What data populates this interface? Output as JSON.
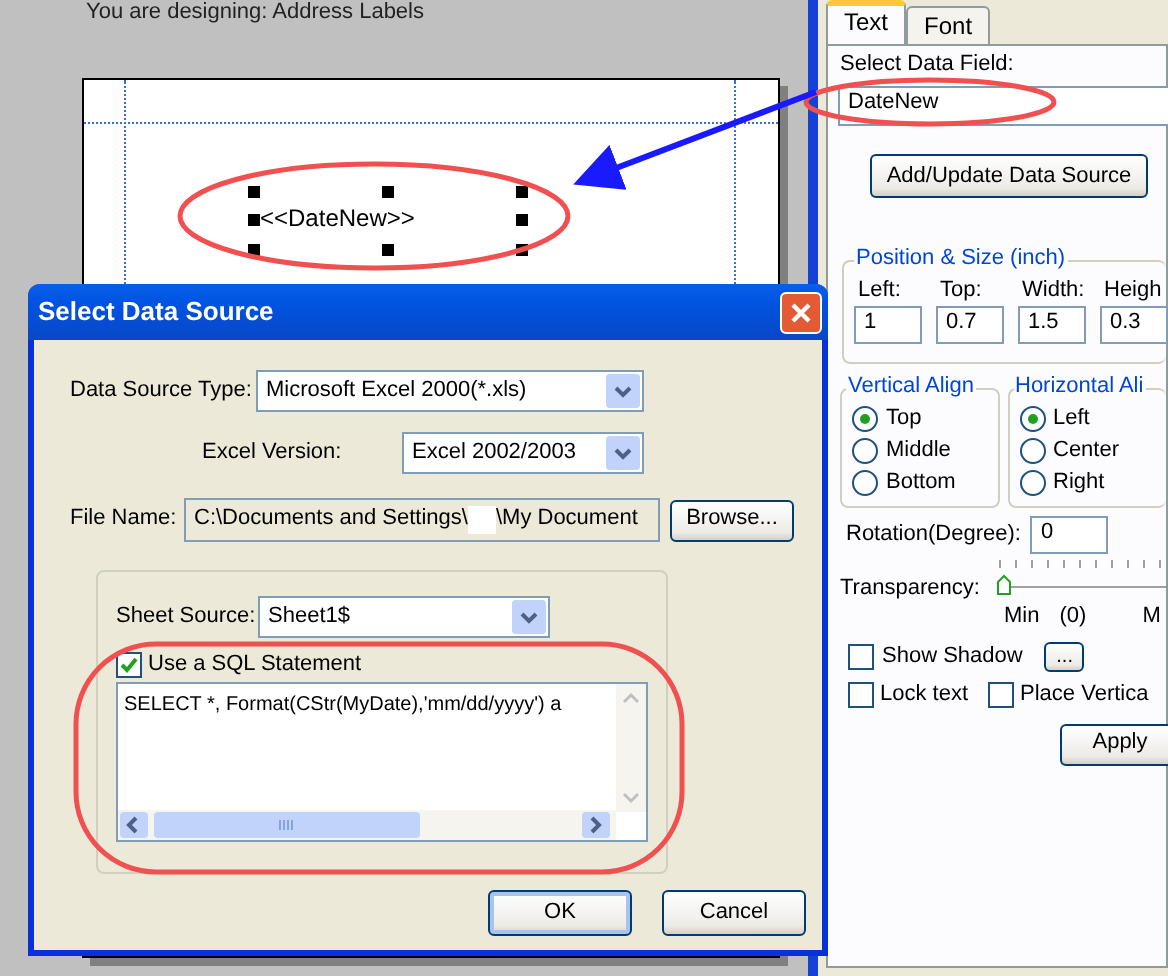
{
  "designer": {
    "heading": "You are designing: Address Labels",
    "field_text": "<<DateNew>>"
  },
  "properties_panel": {
    "tabs": [
      {
        "label": "Text",
        "selected": true
      },
      {
        "label": "Font",
        "selected": false
      }
    ],
    "data_field_label": "Select Data Field:",
    "data_field_value": "DateNew",
    "add_button": "Add/Update Data Source",
    "position_group": {
      "title": "Position & Size (inch)",
      "fields": [
        {
          "label": "Left:",
          "value": "1"
        },
        {
          "label": "Top:",
          "value": "0.7"
        },
        {
          "label": "Width:",
          "value": "1.5"
        },
        {
          "label": "Heigh",
          "value": "0.3"
        }
      ]
    },
    "vertical_align": {
      "title": "Vertical Align",
      "options": [
        {
          "label": "Top",
          "selected": true
        },
        {
          "label": "Middle",
          "selected": false
        },
        {
          "label": "Bottom",
          "selected": false
        }
      ]
    },
    "horizontal_align": {
      "title": "Horizontal Ali",
      "options": [
        {
          "label": "Left",
          "selected": true
        },
        {
          "label": "Center",
          "selected": false
        },
        {
          "label": "Right",
          "selected": false
        }
      ]
    },
    "rotation": {
      "label": "Rotation(Degree):",
      "value": "0"
    },
    "transparency": {
      "label": "Transparency:",
      "level": 0,
      "min_label": "Min",
      "reading": "(0)",
      "max_label": "M"
    },
    "checkboxes": [
      {
        "label": "Show Shadow",
        "checked": false
      },
      {
        "label": "Lock text",
        "checked": false
      },
      {
        "label": "Place Vertica",
        "checked": false
      }
    ],
    "shadow_button": "...",
    "apply_button": "Apply"
  },
  "dialog": {
    "title": "Select Data Source",
    "data_source_type": {
      "label": "Data Source Type:",
      "value": "Microsoft Excel 2000(*.xls)"
    },
    "excel_version": {
      "label": "Excel Version:",
      "value": "Excel 2002/2003"
    },
    "file_name": {
      "label": "File Name:",
      "value_start": "C:\\Documents and Settings\\",
      "value_end": "\\My Document"
    },
    "browse_button": "Browse...",
    "sheet_source": {
      "label": "Sheet Source:",
      "value": "Sheet1$"
    },
    "use_sql": {
      "label": "Use a SQL Statement",
      "checked": true
    },
    "sql": "SELECT *, Format(CStr(MyDate),'mm/dd/yyyy') a",
    "buttons": [
      "OK",
      "Cancel"
    ]
  }
}
